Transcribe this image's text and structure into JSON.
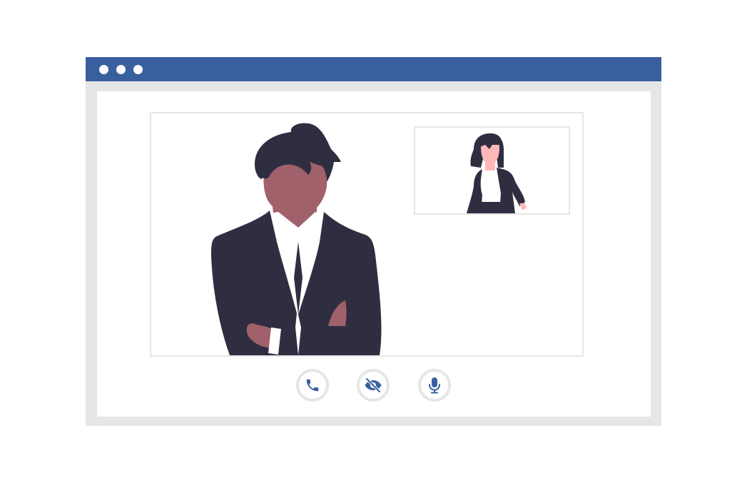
{
  "window": {
    "accent_color": "#3a5f9f",
    "frame_color": "#e6e6e6",
    "titlebar_buttons": [
      "dot",
      "dot",
      "dot"
    ]
  },
  "participants": {
    "main": {
      "figure": "man-arms-crossed"
    },
    "pip": {
      "figure": "woman-standing"
    }
  },
  "controls": [
    {
      "icon": "phone-icon",
      "action": "end-call"
    },
    {
      "icon": "eye-slash-icon",
      "action": "toggle-camera"
    },
    {
      "icon": "microphone-icon",
      "action": "toggle-mic"
    }
  ]
}
